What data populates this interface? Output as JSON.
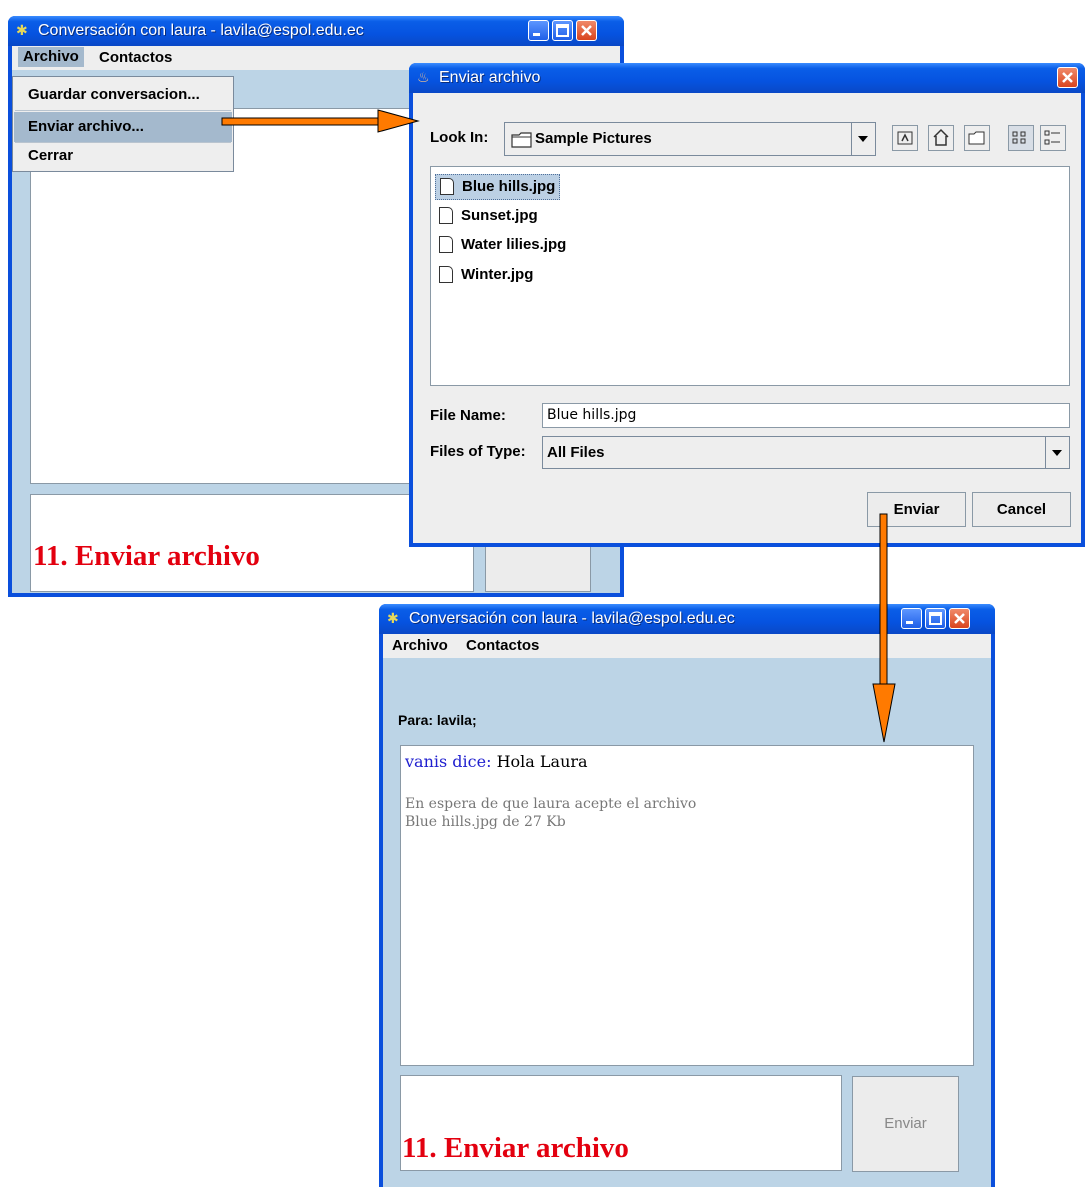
{
  "top_window": {
    "title": "Conversación con laura - lavila@espol.edu.ec",
    "menu": {
      "archivo": "Archivo",
      "contactos": "Contactos"
    },
    "popup_items": [
      "Guardar conversacion...",
      "Enviar archivo...",
      "Cerrar"
    ],
    "caption": "11. Enviar archivo"
  },
  "dialog": {
    "title": "Enviar archivo",
    "look_in_label": "Look In:",
    "look_in_value": "Sample Pictures",
    "files": [
      "Blue hills.jpg",
      "Sunset.jpg",
      "Water lilies.jpg",
      "Winter.jpg"
    ],
    "selected_file": "Blue hills.jpg",
    "file_name_label": "File Name:",
    "file_name_value": "Blue hills.jpg",
    "files_of_type_label": "Files of Type:",
    "files_of_type_value": "All Files",
    "send_button": "Enviar",
    "cancel_button": "Cancel"
  },
  "bottom_window": {
    "title": "Conversación con laura - lavila@espol.edu.ec",
    "menu": {
      "archivo": "Archivo",
      "contactos": "Contactos"
    },
    "para_label": "Para:",
    "para_value": "lavila;",
    "chat": {
      "sender": "vanis dice:",
      "message": "Hola Laura",
      "status_line1": "En espera de que laura acepte el archivo",
      "status_line2": "Blue hills.jpg de 27 Kb"
    },
    "send_button": "Enviar",
    "caption": "11. Enviar archivo"
  },
  "colors": {
    "title_blue": "#0653e0",
    "panel_blue": "#bcd4e6",
    "caption_red": "#e3000f",
    "arrow_orange": "#ff7a00",
    "sender_blue": "#1f1fcf"
  }
}
